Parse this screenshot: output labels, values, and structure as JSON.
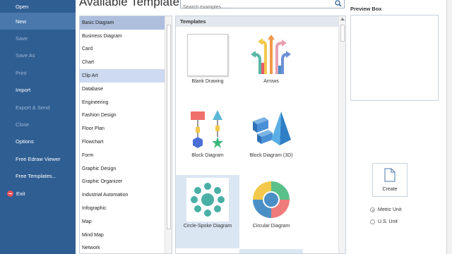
{
  "sidebar": {
    "items": [
      {
        "label": "Open",
        "state": "enabled"
      },
      {
        "label": "New",
        "state": "active"
      },
      {
        "label": "Save",
        "state": "disabled"
      },
      {
        "label": "Save As",
        "state": "disabled"
      },
      {
        "label": "Print",
        "state": "disabled"
      },
      {
        "label": "Import",
        "state": "enabled"
      },
      {
        "label": "Export & Send",
        "state": "disabled"
      },
      {
        "label": "Close",
        "state": "disabled"
      },
      {
        "label": "Options",
        "state": "enabled"
      },
      {
        "label": "Free Edraw Viewer",
        "state": "enabled"
      },
      {
        "label": "Free Templates...",
        "state": "enabled"
      },
      {
        "label": "Exit",
        "state": "enabled"
      }
    ],
    "colors": {
      "background": "#2f5e93",
      "active": "#4a78ad",
      "disabled_text": "#9fb6d2"
    }
  },
  "header": {
    "title": "Available Templates"
  },
  "search": {
    "placeholder": "Search examples . . ."
  },
  "categories": {
    "items": [
      "Basic Diagram",
      "Business Diagram",
      "Card",
      "Chart",
      "Clip Art",
      "Database",
      "Engineering",
      "Fashion Design",
      "Floor Plan",
      "Flowchart",
      "Form",
      "Graphic Design",
      "Graphic Organizer",
      "Industrial Automation",
      "Infographic",
      "Map",
      "Mind Map",
      "Network"
    ],
    "selected": "Basic Diagram",
    "hovered": "Clip Art"
  },
  "templates": {
    "header": "Templates",
    "items": [
      {
        "label": "Blank Drawing",
        "icon": "blank-page-icon"
      },
      {
        "label": "Arrows",
        "icon": "arrows-icon"
      },
      {
        "label": "Block Diagram",
        "icon": "block-diagram-icon"
      },
      {
        "label": "Block Diagram (3D)",
        "icon": "block-diagram-3d-icon"
      },
      {
        "label": "Circle-Spoke Diagram",
        "icon": "circle-spoke-icon",
        "selected": true
      },
      {
        "label": "Circular Diagram",
        "icon": "circular-diagram-icon"
      }
    ]
  },
  "preview": {
    "title": "Preview Box"
  },
  "create": {
    "label": "Create"
  },
  "units": {
    "options": [
      "Metric Unit",
      "U.S. Unit"
    ],
    "selected": "Metric Unit"
  }
}
